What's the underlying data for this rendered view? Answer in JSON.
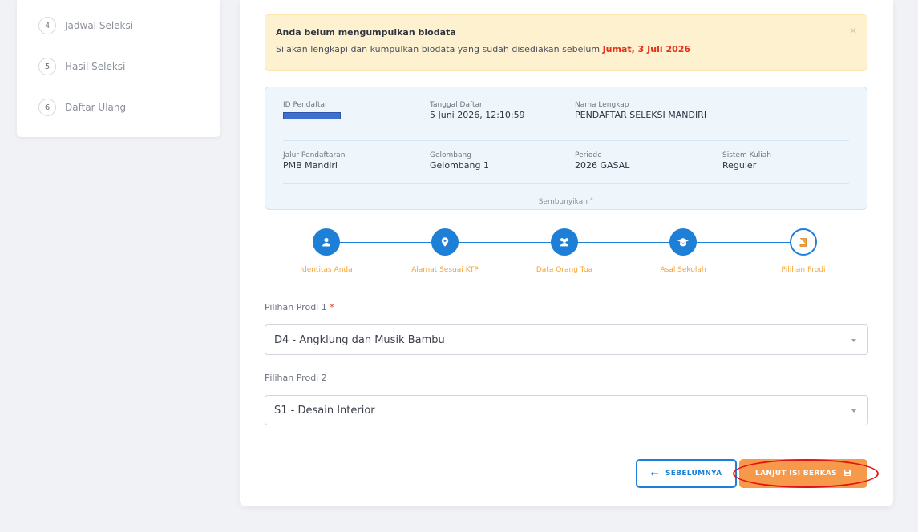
{
  "sidebar": {
    "items": [
      {
        "num": "4",
        "label": "Jadwal Seleksi"
      },
      {
        "num": "5",
        "label": "Hasil Seleksi"
      },
      {
        "num": "6",
        "label": "Daftar Ulang"
      }
    ]
  },
  "alert": {
    "title": "Anda belum mengumpulkan biodata",
    "message": "Silakan lengkapi dan kumpulkan biodata yang sudah disediakan sebelum ",
    "deadline": "Jumat, 3 Juli 2026",
    "close": "×"
  },
  "info": {
    "id_label": "ID Pendaftar",
    "tanggal_label": "Tanggal Daftar",
    "tanggal_value": "5 Juni 2026, 12:10:59",
    "nama_label": "Nama Lengkap",
    "nama_value": "PENDAFTAR SELEKSI MANDIRI",
    "jalur_label": "Jalur Pendaftaran",
    "jalur_value": "PMB Mandiri",
    "gelombang_label": "Gelombang",
    "gelombang_value": "Gelombang 1",
    "periode_label": "Periode",
    "periode_value": "2026 GASAL",
    "sistem_label": "Sistem Kuliah",
    "sistem_value": "Reguler",
    "toggle": "Sembunyikan ˄"
  },
  "stepper": {
    "steps": [
      {
        "label": "Identitas Anda",
        "icon": "user-icon"
      },
      {
        "label": "Alamat Sesuai KTP",
        "icon": "map-pin-icon"
      },
      {
        "label": "Data Orang Tua",
        "icon": "users-icon"
      },
      {
        "label": "Asal Sekolah",
        "icon": "graduation-cap-icon"
      },
      {
        "label": "Pilihan Prodi",
        "icon": "book-icon"
      }
    ],
    "colors": {
      "primary": "#1e7fd6",
      "label": "#f5a43a"
    }
  },
  "form": {
    "prodi1_label": "Pilihan Prodi 1",
    "required_mark": "*",
    "prodi1_value": "D4 - Angklung dan Musik Bambu",
    "prodi2_label": "Pilihan Prodi 2",
    "prodi2_value": "S1 - Desain Interior"
  },
  "buttons": {
    "prev_label": "SEBELUMNYA",
    "next_label": "LANJUT ISI BERKAS",
    "prev_color": "#1e7fd6",
    "next_color": "#f6994a"
  }
}
